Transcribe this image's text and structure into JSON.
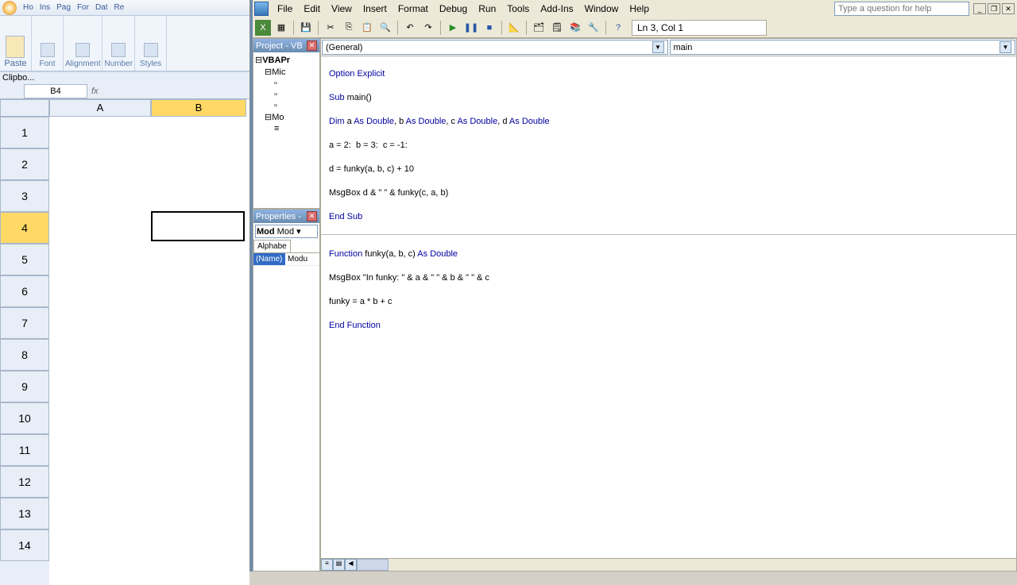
{
  "excel": {
    "ribbon_tabs": [
      "Ho",
      "Ins",
      "Pag",
      "For",
      "Dat",
      "Re"
    ],
    "groups": [
      "Clipbo...",
      "Font",
      "Alignment",
      "Number",
      "Styles"
    ],
    "name_box": "B4",
    "col_headers": [
      "A",
      "B"
    ],
    "row_numbers": [
      "1",
      "2",
      "3",
      "4",
      "5",
      "6",
      "7",
      "8",
      "9",
      "10",
      "11",
      "12",
      "13",
      "14"
    ],
    "selected_row": "4"
  },
  "vbe": {
    "menus": [
      "File",
      "Edit",
      "View",
      "Insert",
      "Format",
      "Debug",
      "Run",
      "Tools",
      "Add-Ins",
      "Window",
      "Help"
    ],
    "help_placeholder": "Type a question for help",
    "cursor_pos": "Ln 3, Col 1",
    "project_title": "Project - VB",
    "properties_title": "Properties -",
    "tree": {
      "root": "VBAPr",
      "items": [
        "Mic",
        "Mo"
      ]
    },
    "prop_combo": "Mod",
    "prop_tab": "Alphabe",
    "prop_name_key": "(Name)",
    "prop_name_val": "Modu",
    "dd_left": "(General)",
    "dd_right": "main",
    "code": {
      "l1_a": "Option Explicit",
      "l2_a": "Sub",
      "l2_b": " main()",
      "l3_a": "Dim",
      "l3_b": " a ",
      "l3_c": "As Double",
      "l3_d": ", b ",
      "l3_e": "As Double",
      "l3_f": ", c ",
      "l3_g": "As Double",
      "l3_h": ", d ",
      "l3_i": "As Double",
      "l4": "a = 2:  b = 3:  c = -1:",
      "l5": "d = funky(a, b, c) + 10",
      "l6": "MsgBox d & \" \" & funky(c, a, b)",
      "l7": "End Sub",
      "l8_a": "Function",
      "l8_b": " funky(a, b, c) ",
      "l8_c": "As Double",
      "l9": "MsgBox \"In funky: \" & a & \" \" & b & \" \" & c",
      "l10": "funky = a * b + c",
      "l11": "End Function"
    }
  }
}
